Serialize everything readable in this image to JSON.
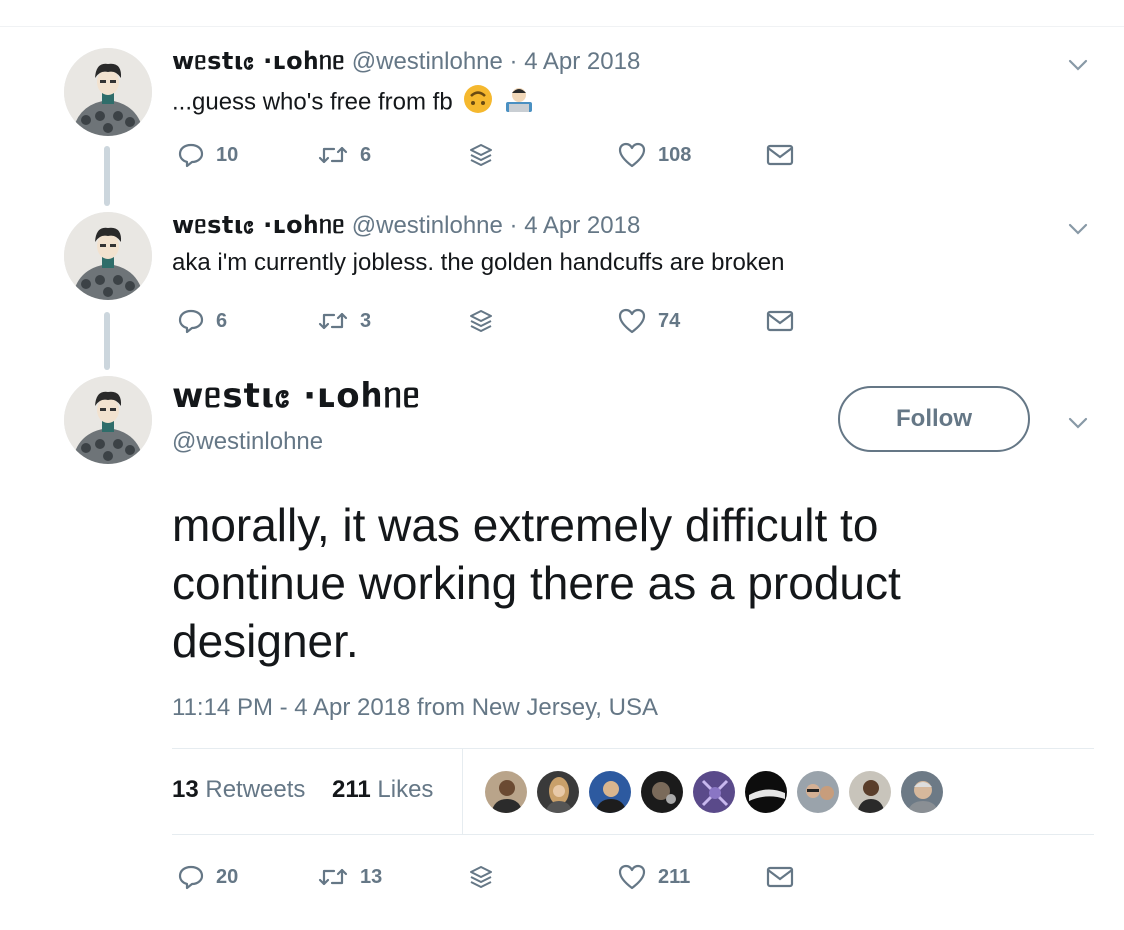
{
  "tweets": [
    {
      "name": "ᴡᥱstι᥋ ·ʟoհᥒᥱ",
      "handle": "@westinlohne",
      "separator": "·",
      "date": "4 Apr 2018",
      "text": "...guess who's free from fb",
      "emojis": [
        "upside-down-face-icon",
        "man-technologist-icon"
      ],
      "replies": "10",
      "retweets": "6",
      "likes": "108"
    },
    {
      "name": "ᴡᥱstι᥋ ·ʟoհᥒᥱ",
      "handle": "@westinlohne",
      "separator": "·",
      "date": "4 Apr 2018",
      "text": "aka i'm currently jobless. the golden handcuffs are broken",
      "replies": "6",
      "retweets": "3",
      "likes": "74"
    }
  ],
  "main_tweet": {
    "name": "ᴡᥱstι᥋ ·ʟoհᥒᥱ",
    "handle": "@westinlohne",
    "follow_label": "Follow",
    "text": "morally, it was extremely difficult to continue working there as a product designer.",
    "meta": "11:14 PM - 4 Apr 2018 from New Jersey, USA",
    "retweet_count": "13",
    "retweet_label": "Retweets",
    "like_count": "211",
    "like_label": "Likes",
    "liker_avatars": 9,
    "replies": "20",
    "retweets": "13",
    "likes": "211"
  },
  "colors": {
    "text": "#14171a",
    "secondary": "#657786",
    "divider": "#e6ecf0",
    "thread_line": "#ccd6dd"
  }
}
